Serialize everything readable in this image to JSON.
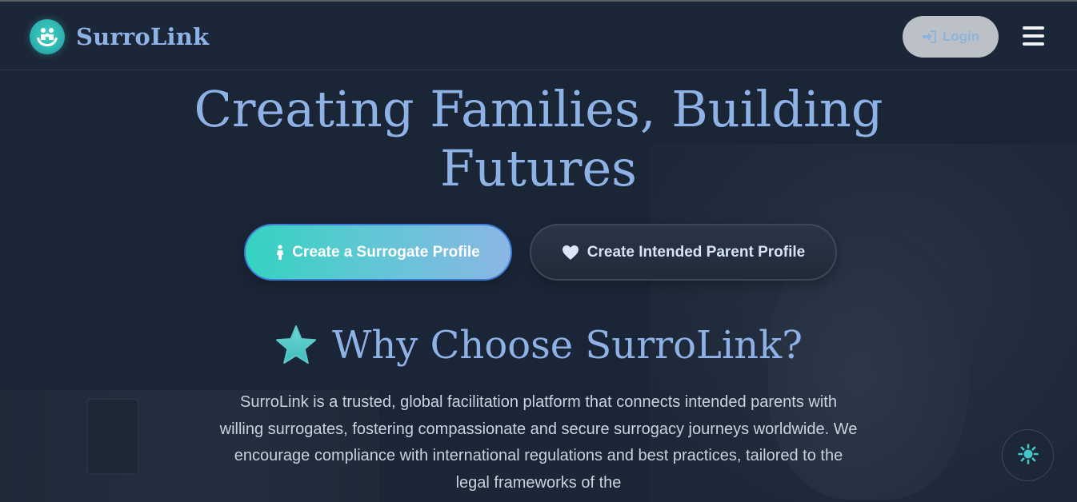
{
  "brand": {
    "name": "SurroLink",
    "logo_icon": "family-hands-icon"
  },
  "header": {
    "login_label": "Login",
    "login_icon": "sign-in-icon",
    "menu_icon": "hamburger-menu-icon"
  },
  "hero": {
    "title": "Creating Families, Building Futures",
    "cta_surrogate": {
      "label": "Create a Surrogate Profile",
      "icon": "person-icon"
    },
    "cta_parent": {
      "label": "Create Intended Parent Profile",
      "icon": "heart-icon"
    }
  },
  "why": {
    "icon": "star-icon",
    "title": "Why Choose SurroLink?",
    "body": "SurroLink is a trusted, global facilitation platform that connects intended parents with willing surrogates, fostering compassionate and secure surrogacy journeys worldwide. We encourage compliance with international regulations and best practices, tailored to the legal frameworks of the"
  },
  "theme_toggle": {
    "icon": "sun-icon"
  },
  "colors": {
    "background": "#192434",
    "accent_text": "#8fb2e6",
    "teal": "#34d3c0",
    "body_text": "#c9d3de"
  }
}
